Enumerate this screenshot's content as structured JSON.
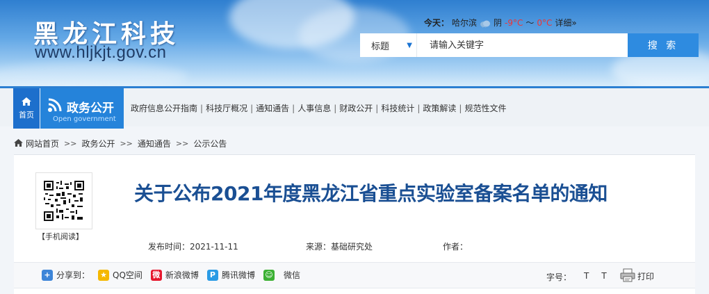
{
  "header": {
    "logo_text": "黑龙江科技",
    "logo_url": "www.hljkjt.gov.cn",
    "weather": {
      "today_label": "今天：",
      "city": "哈尔滨",
      "condition": "阴",
      "low": "-9°C",
      "tilde": "～",
      "high": "0°C",
      "details": "详细»"
    },
    "search": {
      "field_select": "标题",
      "placeholder": "请输入关键字",
      "button": "搜 索"
    }
  },
  "nav": {
    "home": "首页",
    "section_title": "政务公开",
    "section_sub": "Open government",
    "links": [
      "政府信息公开指南",
      "科技厅概况",
      "通知通告",
      "人事信息",
      "财政公开",
      "科技统计",
      "政策解读",
      "规范性文件"
    ],
    "separator": "|"
  },
  "breadcrumb": {
    "items": [
      "网站首页",
      "政务公开",
      "通知通告",
      "公示公告"
    ],
    "separator": ">>"
  },
  "article": {
    "qr_label": "【手机阅读】",
    "title": "关于公布2021年度黑龙江省重点实验室备案名单的通知",
    "publish": "发布时间：2021-11-11",
    "source": "来源：基础研究处",
    "author": "作者："
  },
  "share": {
    "label": "分享到：",
    "items": [
      "QQ空间",
      "新浪微博",
      "腾讯微博",
      "微信"
    ],
    "font_label": "字号：",
    "font_large": "T",
    "font_small": "T",
    "print": "打印"
  },
  "colors": {
    "accent": "#2583da",
    "title": "#1a4f93",
    "search_button": "#2e8be0"
  }
}
